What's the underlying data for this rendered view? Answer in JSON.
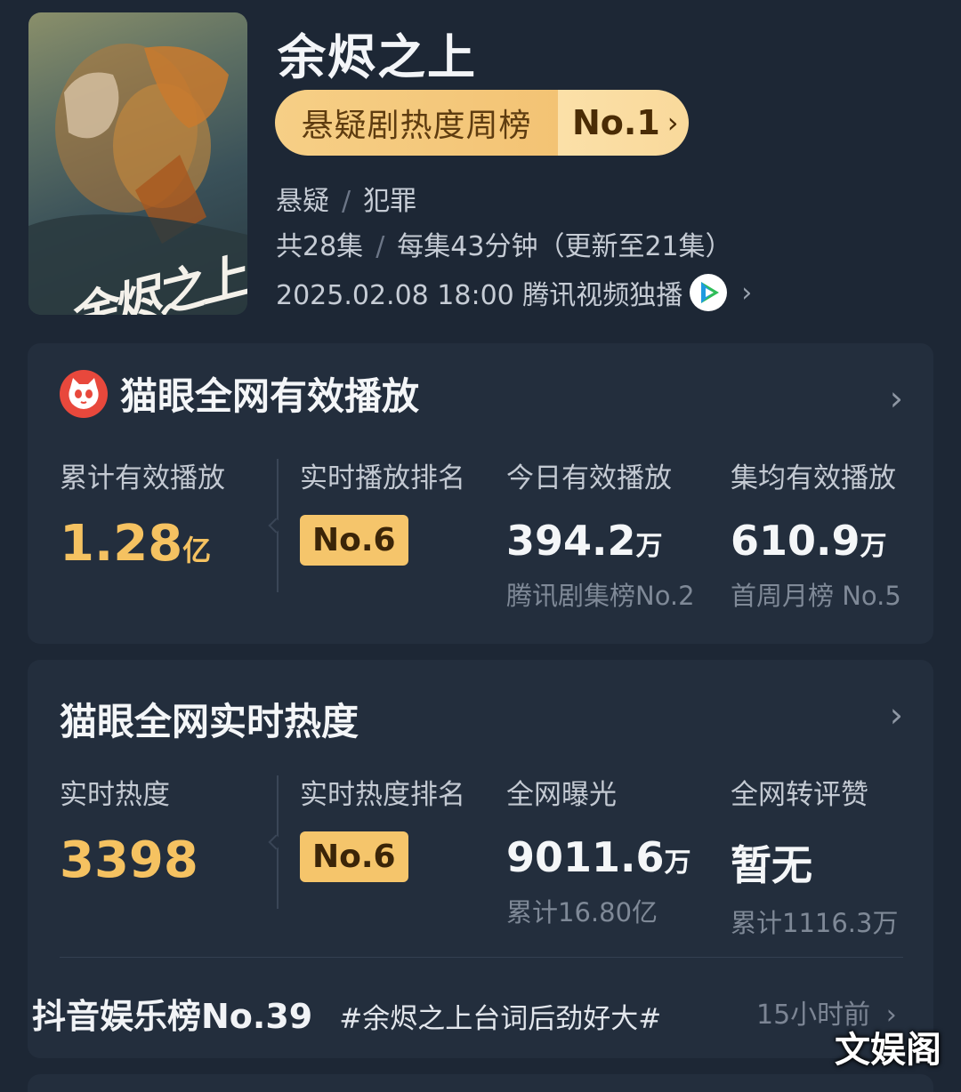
{
  "show": {
    "title": "余烬之上",
    "poster_logo_text": "余烬之上",
    "rank_label": "悬疑剧热度周榜",
    "rank_value": "No.1",
    "genre_1": "悬疑",
    "genre_2": "犯罪",
    "episodes_total": "共28集",
    "episode_info": "每集43分钟（更新至21集）",
    "airtime": "2025.02.08 18:00 腾讯视频独播",
    "platform_icon": "tencent-video-icon"
  },
  "card_play": {
    "title": "猫眼全网有效播放",
    "icon": "maoyan-cat-icon",
    "cols": [
      {
        "label": "累计有效播放",
        "value": "1.28",
        "unit": "亿"
      },
      {
        "label": "实时播放排名",
        "badge": "No.6"
      },
      {
        "label": "今日有效播放",
        "value": "394.2",
        "unit": "万",
        "sub": "腾讯剧集榜No.2"
      },
      {
        "label": "集均有效播放",
        "value": "610.9",
        "unit": "万",
        "sub": "首周月榜 No.5"
      }
    ]
  },
  "card_heat": {
    "title": "猫眼全网实时热度",
    "cols": [
      {
        "label": "实时热度",
        "value": "3398"
      },
      {
        "label": "实时热度排名",
        "badge": "No.6"
      },
      {
        "label": "全网曝光",
        "value": "9011.6",
        "unit": "万",
        "sub": "累计16.80亿"
      },
      {
        "label": "全网转评赞",
        "value": "暂无",
        "sub": "累计1116.3万"
      }
    ],
    "douyin_rank": "抖音娱乐榜No.39",
    "douyin_topic": "#余烬之上台词后劲好大#",
    "douyin_time": "15小时前"
  },
  "watermark": "文娱阁",
  "colors": {
    "gold": "#f5c261",
    "background": "#1d2735",
    "card": "#232e3d"
  }
}
